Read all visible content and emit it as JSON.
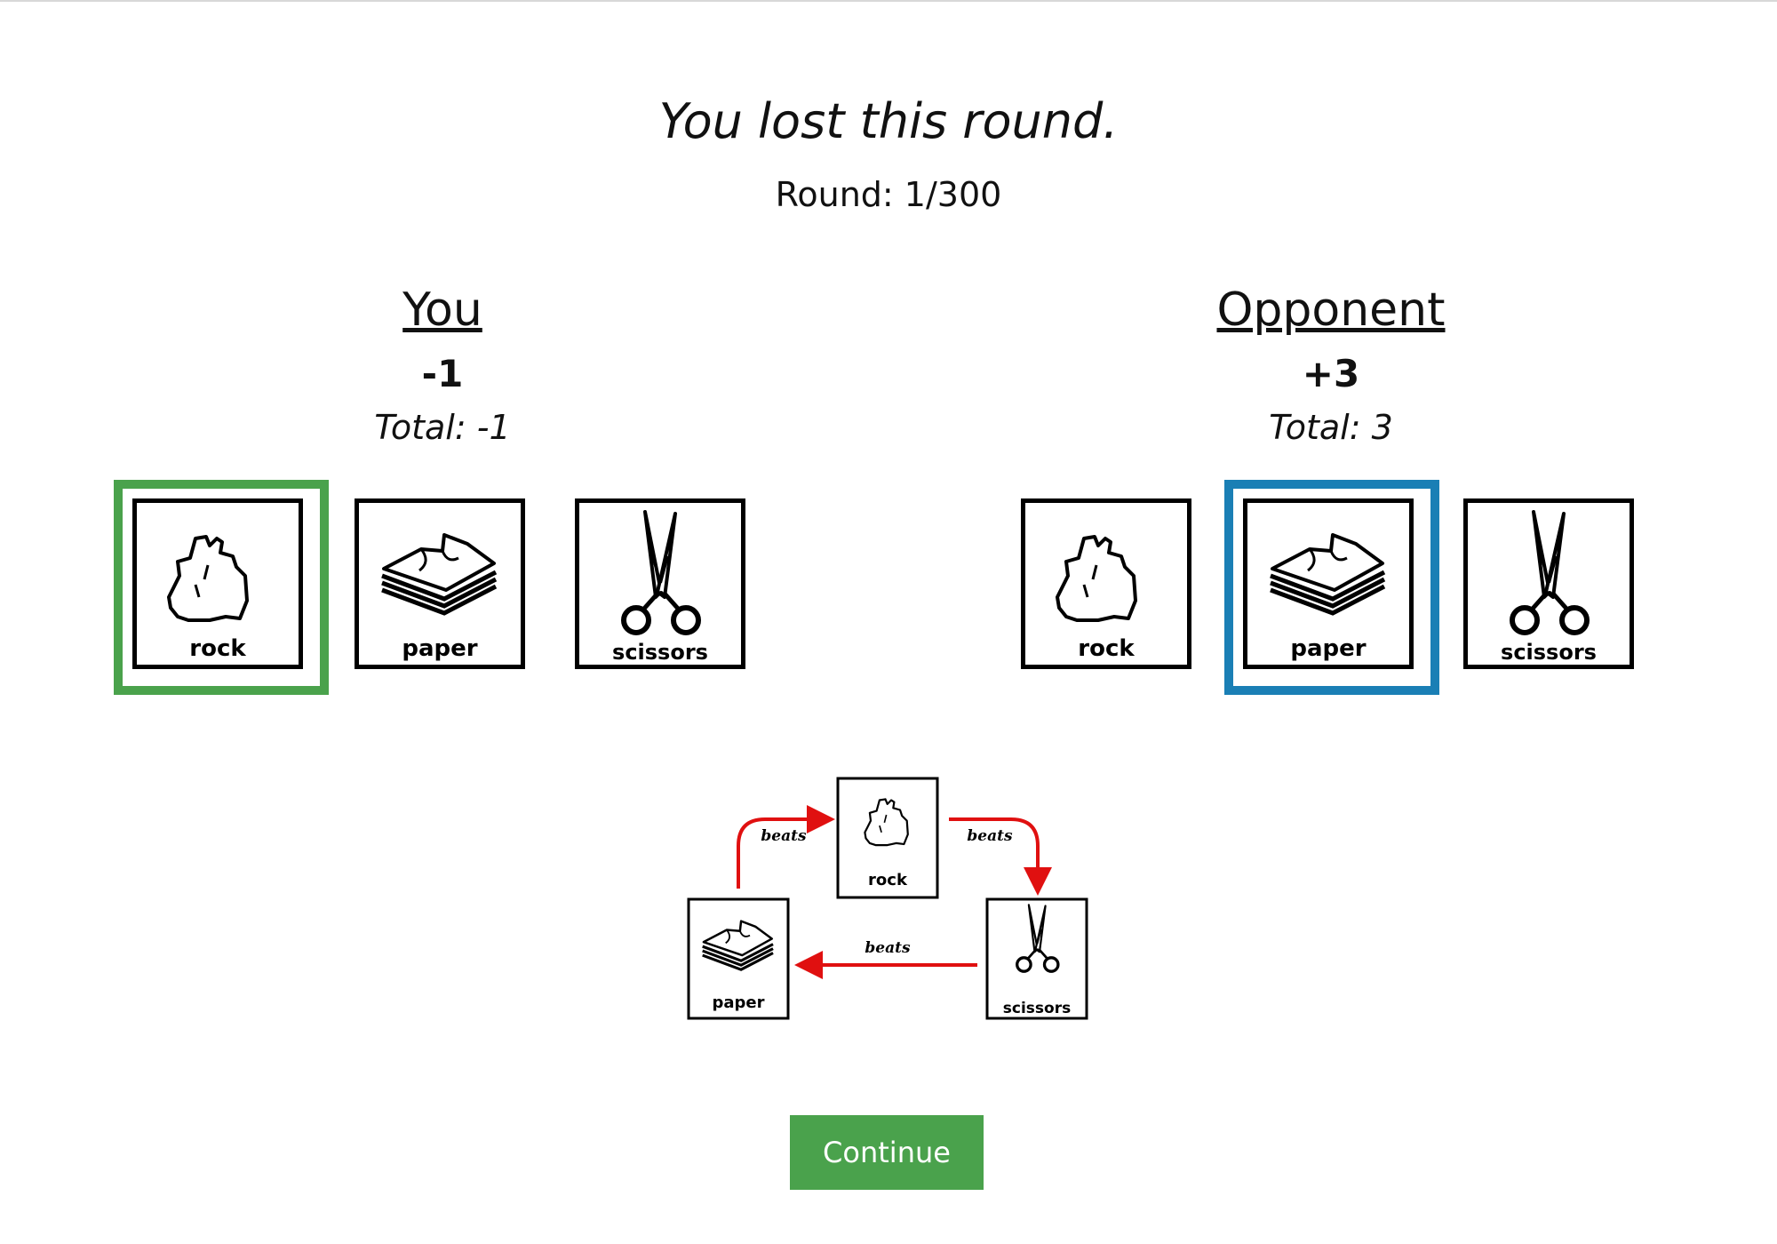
{
  "result_text": "You lost this round.",
  "round_text": "Round: 1/300",
  "you": {
    "name": "You",
    "delta": "-1",
    "total": "Total: -1",
    "selected": "rock",
    "highlight_color": "#4aa24c"
  },
  "opponent": {
    "name": "Opponent",
    "delta": "+3",
    "total": "Total: 3",
    "selected": "paper",
    "highlight_color": "#1a7fb5"
  },
  "cards": {
    "rock": "rock",
    "paper": "paper",
    "scissors": "scissors"
  },
  "diagram": {
    "beats_1": "beats",
    "beats_2": "beats",
    "beats_3": "beats",
    "rock": "rock",
    "paper": "paper",
    "scissors": "scissors",
    "arrow_color": "#e01010"
  },
  "continue_label": "Continue"
}
